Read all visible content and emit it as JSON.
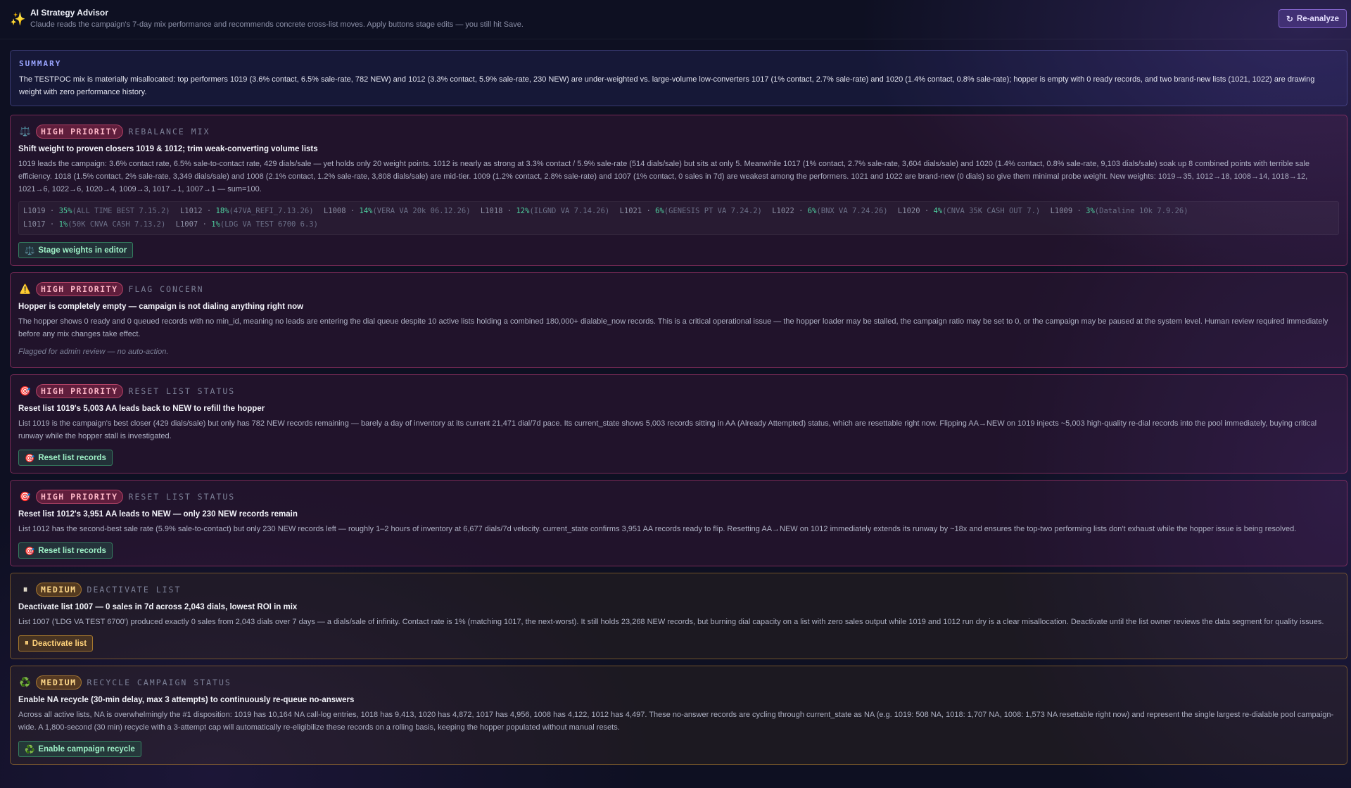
{
  "header": {
    "title": "AI Strategy Advisor",
    "subtitle": "Claude reads the campaign's 7-day mix performance and recommends concrete cross-list moves. Apply buttons stage edits — you still hit Save.",
    "reanalyze_label": "Re-analyze"
  },
  "summary": {
    "label": "SUMMARY",
    "text": "The TESTPOC mix is materially misallocated: top performers 1019 (3.6% contact, 6.5% sale-rate, 782 NEW) and 1012 (3.3% contact, 5.9% sale-rate, 230 NEW) are under-weighted vs. large-volume low-converters 1017 (1% contact, 2.7% sale-rate) and 1020 (1.4% contact, 0.8% sale-rate); hopper is empty with 0 ready records, and two brand-new lists (1021, 1022) are drawing weight with zero performance history."
  },
  "cards": [
    {
      "priority": "HIGH PRIORITY",
      "kind": "REBALANCE MIX",
      "icon": "scale-icon",
      "title": "Shift weight to proven closers 1019 & 1012; trim weak-converting volume lists",
      "desc": "1019 leads the campaign: 3.6% contact rate, 6.5% sale-to-contact rate, 429 dials/sale — yet holds only 20 weight points. 1012 is nearly as strong at 3.3% contact / 5.9% sale-rate (514 dials/sale) but sits at only 5. Meanwhile 1017 (1% contact, 2.7% sale-rate, 3,604 dials/sale) and 1020 (1.4% contact, 0.8% sale-rate, 9,103 dials/sale) soak up 8 combined points with terrible sale efficiency. 1018 (1.5% contact, 2% sale-rate, 3,349 dials/sale) and 1008 (2.1% contact, 1.2% sale-rate, 3,808 dials/sale) are mid-tier. 1009 (1.2% contact, 2.8% sale-rate) and 1007 (1% contact, 0 sales in 7d) are weakest among the performers. 1021 and 1022 are brand-new (0 dials) so give them minimal probe weight. New weights: 1019→35, 1012→18, 1008→14, 1018→12, 1021→6, 1022→6, 1020→4, 1009→3, 1017→1, 1007→1 — sum=100.",
      "weights": [
        {
          "list": "L1019",
          "pct": "35%",
          "name": "(ALL TIME BEST 7.15.2)"
        },
        {
          "list": "L1012",
          "pct": "18%",
          "name": "(47VA_REFI_7.13.26)"
        },
        {
          "list": "L1008",
          "pct": "14%",
          "name": "(VERA VA 20k 06.12.26)"
        },
        {
          "list": "L1018",
          "pct": "12%",
          "name": "(ILGND VA 7.14.26)"
        },
        {
          "list": "L1021",
          "pct": "6%",
          "name": "(GENESIS PT VA 7.24.2)"
        },
        {
          "list": "L1022",
          "pct": "6%",
          "name": "(BNX VA 7.24.26)"
        },
        {
          "list": "L1020",
          "pct": "4%",
          "name": "(CNVA 35K CASH OUT 7.)"
        },
        {
          "list": "L1009",
          "pct": "3%",
          "name": "(Dataline 10k 7.9.26)"
        },
        {
          "list": "L1017",
          "pct": "1%",
          "name": "(50K CNVA CASH 7.13.2)"
        },
        {
          "list": "L1007",
          "pct": "1%",
          "name": "(LDG VA TEST 6700 6.3)"
        }
      ],
      "action": "Stage weights in editor"
    },
    {
      "priority": "HIGH PRIORITY",
      "kind": "FLAG CONCERN",
      "icon": "warning-icon",
      "title": "Hopper is completely empty — campaign is not dialing anything right now",
      "desc": "The hopper shows 0 ready and 0 queued records with no min_id, meaning no leads are entering the dial queue despite 10 active lists holding a combined 180,000+ dialable_now records. This is a critical operational issue — the hopper loader may be stalled, the campaign ratio may be set to 0, or the campaign may be paused at the system level. Human review required immediately before any mix changes take effect.",
      "note": "Flagged for admin review — no auto-action."
    },
    {
      "priority": "HIGH PRIORITY",
      "kind": "RESET LIST STATUS",
      "icon": "target-icon",
      "title": "Reset list 1019's 5,003 AA leads back to NEW to refill the hopper",
      "desc": "List 1019 is the campaign's best closer (429 dials/sale) but only has 782 NEW records remaining — barely a day of inventory at its current 21,471 dial/7d pace. Its current_state shows 5,003 records sitting in AA (Already Attempted) status, which are resettable right now. Flipping AA→NEW on 1019 injects ~5,003 high-quality re-dial records into the pool immediately, buying critical runway while the hopper stall is investigated.",
      "action": "Reset list records"
    },
    {
      "priority": "HIGH PRIORITY",
      "kind": "RESET LIST STATUS",
      "icon": "target-icon",
      "title": "Reset list 1012's 3,951 AA leads to NEW — only 230 NEW records remain",
      "desc": "List 1012 has the second-best sale rate (5.9% sale-to-contact) but only 230 NEW records left — roughly 1–2 hours of inventory at 6,677 dials/7d velocity. current_state confirms 3,951 AA records ready to flip. Resetting AA→NEW on 1012 immediately extends its runway by ~18x and ensures the top-two performing lists don't exhaust while the hopper issue is being resolved.",
      "action": "Reset list records"
    },
    {
      "priority": "MEDIUM",
      "kind": "DEACTIVATE LIST",
      "icon": "pause-icon",
      "title": "Deactivate list 1007 — 0 sales in 7d across 2,043 dials, lowest ROI in mix",
      "desc": "List 1007 ('LDG VA TEST 6700') produced exactly 0 sales from 2,043 dials over 7 days — a dials/sale of infinity. Contact rate is 1% (matching 1017, the next-worst). It still holds 23,268 NEW records, but burning dial capacity on a list with zero sales output while 1019 and 1012 run dry is a clear misallocation. Deactivate until the list owner reviews the data segment for quality issues.",
      "action": "Deactivate list"
    },
    {
      "priority": "MEDIUM",
      "kind": "RECYCLE CAMPAIGN STATUS",
      "icon": "recycle-icon",
      "title": "Enable NA recycle (30-min delay, max 3 attempts) to continuously re-queue no-answers",
      "desc": "Across all active lists, NA is overwhelmingly the #1 disposition: 1019 has 10,164 NA call-log entries, 1018 has 9,413, 1020 has 4,872, 1017 has 4,956, 1008 has 4,122, 1012 has 4,497. These no-answer records are cycling through current_state as NA (e.g. 1019: 508 NA, 1018: 1,707 NA, 1008: 1,573 NA resettable right now) and represent the single largest re-dialable pool campaign-wide. A 1,800-second (30 min) recycle with a 3-attempt cap will automatically re-eligibilize these records on a rolling basis, keeping the hopper populated without manual resets.",
      "action": "Enable campaign recycle"
    }
  ]
}
